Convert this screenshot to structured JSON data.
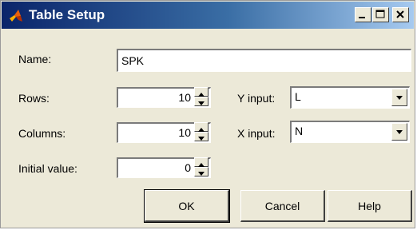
{
  "window": {
    "title": "Table Setup"
  },
  "form": {
    "name_label": "Name:",
    "name_value": "SPK",
    "rows_label": "Rows:",
    "rows_value": "10",
    "columns_label": "Columns:",
    "columns_value": "10",
    "initial_label": "Initial value:",
    "initial_value": "0",
    "y_input_label": "Y input:",
    "y_input_value": "L",
    "x_input_label": "X input:",
    "x_input_value": "N"
  },
  "buttons": {
    "ok": "OK",
    "cancel": "Cancel",
    "help": "Help"
  },
  "icons": {
    "app": "matlab-icon",
    "minimize": "minimize-icon",
    "maximize": "maximize-icon",
    "close": "close-icon",
    "spin_up": "triangle-up-icon",
    "spin_down": "triangle-down-icon",
    "dropdown": "chevron-down-icon"
  },
  "colors": {
    "title_start": "#0a246a",
    "title_end": "#a6caf0",
    "dialog_bg": "#ece9d8"
  }
}
